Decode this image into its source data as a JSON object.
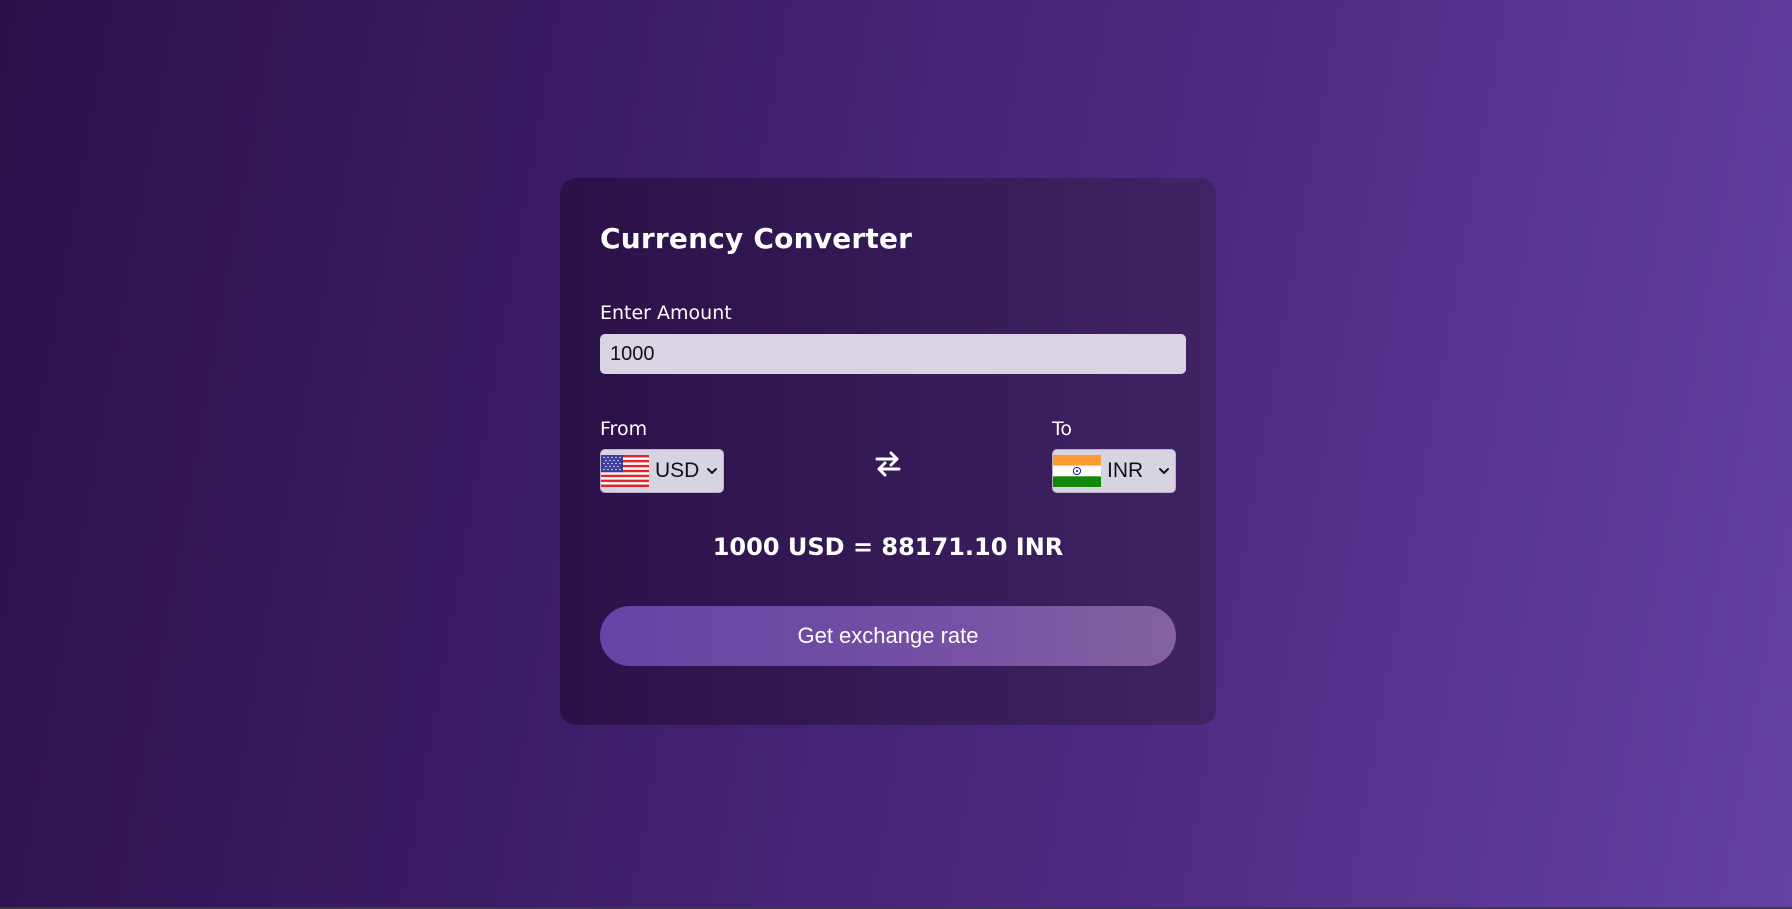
{
  "app": {
    "title": "Currency Converter"
  },
  "amount": {
    "label": "Enter Amount",
    "value": "1000",
    "placeholder": ""
  },
  "from": {
    "label": "From",
    "currency": "USD",
    "flag": "us-flag-icon"
  },
  "to": {
    "label": "To",
    "currency": "INR",
    "flag": "india-flag-icon"
  },
  "swap": {
    "icon": "swap-arrows-icon"
  },
  "result": {
    "text": "1000 USD = 88171.10 INR"
  },
  "button": {
    "label": "Get exchange rate"
  },
  "colors": {
    "background_start": "#2d0f4c",
    "background_end": "#6541a3",
    "card": "#341a56",
    "button_start": "#6444a5",
    "button_end": "#8562a2",
    "input_bg": "#d9d3e2"
  }
}
